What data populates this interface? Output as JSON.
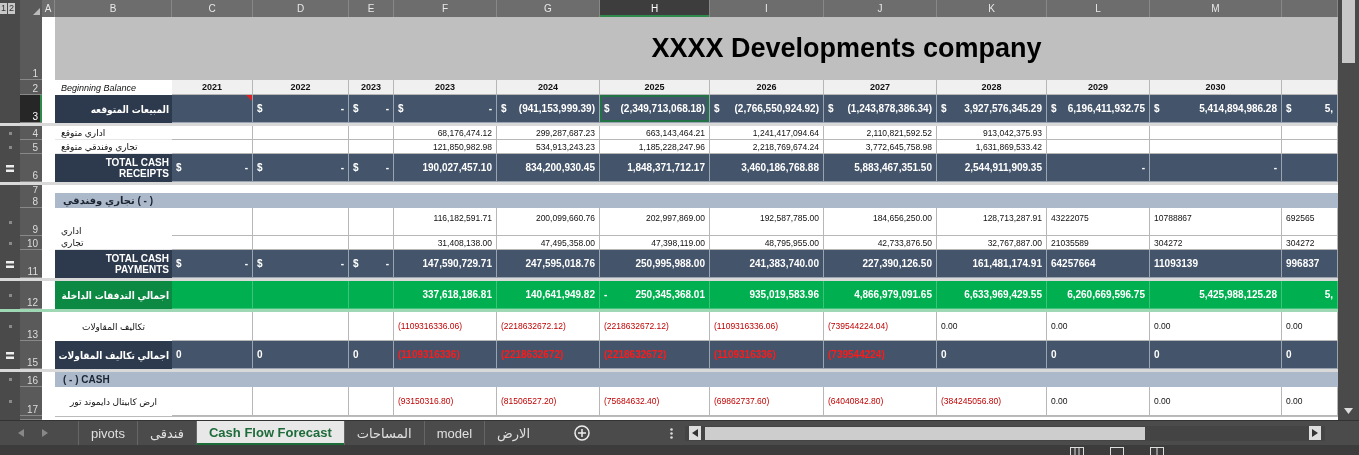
{
  "outline_levels": [
    "1",
    "2"
  ],
  "columns": [
    {
      "letter": "A",
      "selected": false
    },
    {
      "letter": "B",
      "selected": false
    },
    {
      "letter": "C",
      "selected": false
    },
    {
      "letter": "D",
      "selected": false
    },
    {
      "letter": "E",
      "selected": false
    },
    {
      "letter": "F",
      "selected": false
    },
    {
      "letter": "G",
      "selected": false
    },
    {
      "letter": "H",
      "selected": true
    },
    {
      "letter": "I",
      "selected": false
    },
    {
      "letter": "J",
      "selected": false
    },
    {
      "letter": "K",
      "selected": false
    },
    {
      "letter": "L",
      "selected": false
    },
    {
      "letter": "M",
      "selected": false
    }
  ],
  "title": "XXXX  Developments company",
  "rows": [
    {
      "number": "1",
      "kind": "title",
      "selected": false,
      "grouped": false,
      "summary": false
    },
    {
      "number": "2",
      "kind": "years",
      "selected": false,
      "grouped": false,
      "summary": false,
      "label": "Beginning Balance",
      "cells": [
        {
          "value": "2021"
        },
        {
          "value": "2022"
        },
        {
          "value": "2023"
        },
        {
          "value": "2023"
        },
        {
          "value": "2024"
        },
        {
          "value": "2025"
        },
        {
          "value": "2026"
        },
        {
          "value": "2027"
        },
        {
          "value": "2028"
        },
        {
          "value": "2029"
        },
        {
          "value": "2030"
        },
        null
      ]
    },
    {
      "number": "3",
      "kind": "dark",
      "selected": true,
      "grouped": false,
      "summary": false,
      "label": "المبيعات المتوقعه",
      "cells": [
        {
          "comment": true
        },
        {
          "sign": "$",
          "value": "-"
        },
        {
          "sign": "$",
          "value": "-"
        },
        {
          "sign": "$",
          "value": "-"
        },
        {
          "sign": "$",
          "value": "(941,153,999.39)"
        },
        {
          "sign": "$",
          "value": "(2,349,713,068.18)"
        },
        {
          "sign": "$",
          "value": "(2,766,550,924.92)"
        },
        {
          "sign": "$",
          "value": "(1,243,878,386.34)"
        },
        {
          "sign": "$",
          "value": "3,927,576,345.29"
        },
        {
          "sign": "$",
          "value": "6,196,411,932.75"
        },
        {
          "sign": "$",
          "value": "5,414,894,986.28"
        },
        {
          "sign": "$",
          "value": "5,"
        }
      ]
    },
    {
      "number": "4",
      "kind": "plain",
      "selected": false,
      "grouped": true,
      "summary": false,
      "label": "اداري متوقع",
      "cells": [
        null,
        null,
        null,
        {
          "value": "68,176,474.12"
        },
        {
          "value": "299,287,687.23"
        },
        {
          "value": "663,143,464.21"
        },
        {
          "value": "1,241,417,094.64"
        },
        {
          "value": "2,110,821,592.52"
        },
        {
          "value": "913,042,375.93"
        },
        null,
        null,
        null
      ]
    },
    {
      "number": "5",
      "kind": "plain",
      "selected": false,
      "grouped": true,
      "summary": false,
      "label": "تجاري وفندقي متوقع",
      "cells": [
        null,
        null,
        null,
        {
          "value": "121,850,982.98"
        },
        {
          "value": "534,913,243.23"
        },
        {
          "value": "1,185,228,247.96"
        },
        {
          "value": "2,218,769,674.24"
        },
        {
          "value": "3,772,645,758.98"
        },
        {
          "value": "1,631,869,533.42"
        },
        null,
        null,
        null
      ]
    },
    {
      "number": "6",
      "kind": "dark",
      "selected": false,
      "grouped": false,
      "summary": true,
      "label": "TOTAL CASH RECEIPTS",
      "cells": [
        {
          "sign": "$",
          "value": "-"
        },
        {
          "sign": "$",
          "value": "-"
        },
        {
          "sign": "$",
          "value": "-"
        },
        {
          "value": "190,027,457.10"
        },
        {
          "value": "834,200,930.45"
        },
        {
          "value": "1,848,371,712.17"
        },
        {
          "value": "3,460,186,768.88"
        },
        {
          "value": "5,883,467,351.50"
        },
        {
          "value": "2,544,911,909.35"
        },
        {
          "value": "-"
        },
        {
          "value": "-"
        },
        null
      ]
    },
    {
      "number": "7",
      "kind": "spacer",
      "selected": false,
      "grouped": false,
      "summary": false
    },
    {
      "number": "8",
      "kind": "band",
      "selected": false,
      "grouped": false,
      "summary": false,
      "label": "تجاري وفندقي ( - )"
    },
    {
      "number": "9",
      "kind": "plain-tall",
      "selected": false,
      "grouped": true,
      "summary": false,
      "label": "اداري",
      "cells": [
        null,
        null,
        null,
        {
          "value": "116,182,591.71"
        },
        {
          "value": "200,099,660.76"
        },
        {
          "value": "202,997,869.00"
        },
        {
          "value": "192,587,785.00"
        },
        {
          "value": "184,656,250.00"
        },
        {
          "value": "128,713,287.91"
        },
        {
          "value": "43222075",
          "kind": "text"
        },
        {
          "value": "10788867",
          "kind": "text"
        },
        {
          "value": "692565",
          "kind": "text"
        }
      ]
    },
    {
      "number": "10",
      "kind": "plain",
      "selected": false,
      "grouped": true,
      "summary": false,
      "label": "تجاري",
      "cells": [
        null,
        null,
        null,
        {
          "value": "31,408,138.00"
        },
        {
          "value": "47,495,358.00"
        },
        {
          "value": "47,398,119.00"
        },
        {
          "value": "48,795,955.00"
        },
        {
          "value": "42,733,876.50"
        },
        {
          "value": "32,767,887.00"
        },
        {
          "value": "21035589",
          "kind": "text"
        },
        {
          "value": "304272",
          "kind": "text"
        },
        {
          "value": "304272",
          "kind": "text"
        }
      ]
    },
    {
      "number": "11",
      "kind": "dark",
      "selected": false,
      "grouped": false,
      "summary": true,
      "label": "TOTAL CASH PAYMENTS",
      "cells": [
        {
          "sign": "$",
          "value": "-"
        },
        {
          "sign": "$",
          "value": "-"
        },
        {
          "sign": "$",
          "value": "-"
        },
        {
          "value": "147,590,729.71"
        },
        {
          "value": "247,595,018.76"
        },
        {
          "value": "250,995,988.00"
        },
        {
          "value": "241,383,740.00"
        },
        {
          "value": "227,390,126.50"
        },
        {
          "value": "161,481,174.91"
        },
        {
          "value": "64257664",
          "kind": "text"
        },
        {
          "value": "11093139",
          "kind": "text"
        },
        {
          "value": "996837",
          "kind": "text"
        }
      ]
    },
    {
      "number": "12",
      "kind": "green",
      "selected": false,
      "grouped": true,
      "summary": false,
      "label": "اجمالي التدفقات الداخلة",
      "cells": [
        null,
        null,
        null,
        {
          "value": "337,618,186.81"
        },
        {
          "value": "140,641,949.82"
        },
        {
          "sign": "-",
          "value": "250,345,368.01"
        },
        {
          "value": "935,019,583.96"
        },
        {
          "value": "4,866,979,091.65"
        },
        {
          "value": "6,633,969,429.55"
        },
        {
          "value": "6,260,669,596.75"
        },
        {
          "value": "5,425,988,125.28"
        },
        {
          "value": "5,"
        }
      ]
    },
    {
      "number": "13",
      "kind": "entry",
      "selected": false,
      "grouped": true,
      "summary": false,
      "label": "تكاليف المقاولات",
      "cells": [
        null,
        null,
        null,
        {
          "value": "(1109316336.06)",
          "kind": "text",
          "negative": true
        },
        {
          "value": "(2218632672.12)",
          "kind": "text",
          "negative": true
        },
        {
          "value": "(2218632672.12)",
          "kind": "text",
          "negative": true
        },
        {
          "value": "(1109316336.06)",
          "kind": "text",
          "negative": true
        },
        {
          "value": "(739544224.04)",
          "kind": "text",
          "negative": true
        },
        {
          "value": "0.00",
          "kind": "text",
          "negative": false
        },
        {
          "value": "0.00",
          "kind": "text",
          "negative": false
        },
        {
          "value": "0.00",
          "kind": "text",
          "negative": false
        },
        {
          "value": "0.00",
          "kind": "text",
          "negative": false
        }
      ]
    },
    {
      "number": "15",
      "kind": "dark",
      "selected": false,
      "grouped": false,
      "summary": true,
      "label": "اجمالي تكاليف المقاولات",
      "cells": [
        {
          "value": "0",
          "kind": "text",
          "negative": false
        },
        {
          "value": "0",
          "kind": "text",
          "negative": false
        },
        {
          "value": "0",
          "kind": "text",
          "negative": false
        },
        {
          "value": "(1109316336)",
          "kind": "text",
          "negative": true
        },
        {
          "value": "(2218632672)",
          "kind": "text",
          "negative": true
        },
        {
          "value": "(2218632672)",
          "kind": "text",
          "negative": true
        },
        {
          "value": "(1109316336)",
          "kind": "text",
          "negative": true
        },
        {
          "value": "(739544224)",
          "kind": "text",
          "negative": true
        },
        {
          "value": "0",
          "kind": "text",
          "negative": false
        },
        {
          "value": "0",
          "kind": "text",
          "negative": false
        },
        {
          "value": "0",
          "kind": "text",
          "negative": false
        },
        {
          "value": "0",
          "kind": "text",
          "negative": false
        }
      ]
    },
    {
      "number": "16",
      "kind": "band",
      "selected": false,
      "grouped": true,
      "summary": false,
      "label": "( - )  CASH"
    },
    {
      "number": "17",
      "kind": "entry",
      "selected": false,
      "grouped": true,
      "summary": false,
      "label": "ارض كابيتال دايموند تور",
      "cells": [
        null,
        null,
        null,
        {
          "value": "(93150316.80)",
          "kind": "text",
          "negative": true
        },
        {
          "value": "(81506527.20)",
          "kind": "text",
          "negative": true
        },
        {
          "value": "(75684632.40)",
          "kind": "text",
          "negative": true
        },
        {
          "value": "(69862737.60)",
          "kind": "text",
          "negative": true
        },
        {
          "value": "(64040842.80)",
          "kind": "text",
          "negative": true
        },
        {
          "value": "(384245056.80)",
          "kind": "text",
          "negative": true
        },
        {
          "value": "0.00",
          "kind": "text",
          "negative": false
        },
        {
          "value": "0.00",
          "kind": "text",
          "negative": false
        },
        {
          "value": "0.00",
          "kind": "text",
          "negative": false
        }
      ]
    }
  ],
  "sheet_tabs": [
    {
      "label": "pivots",
      "selected": false
    },
    {
      "label": "فندقى",
      "selected": false
    },
    {
      "label": "Cash Flow Forecast",
      "selected": true
    },
    {
      "label": "المساحات",
      "selected": false
    },
    {
      "label": "model",
      "selected": false
    },
    {
      "label": "الارض",
      "selected": false
    }
  ]
}
